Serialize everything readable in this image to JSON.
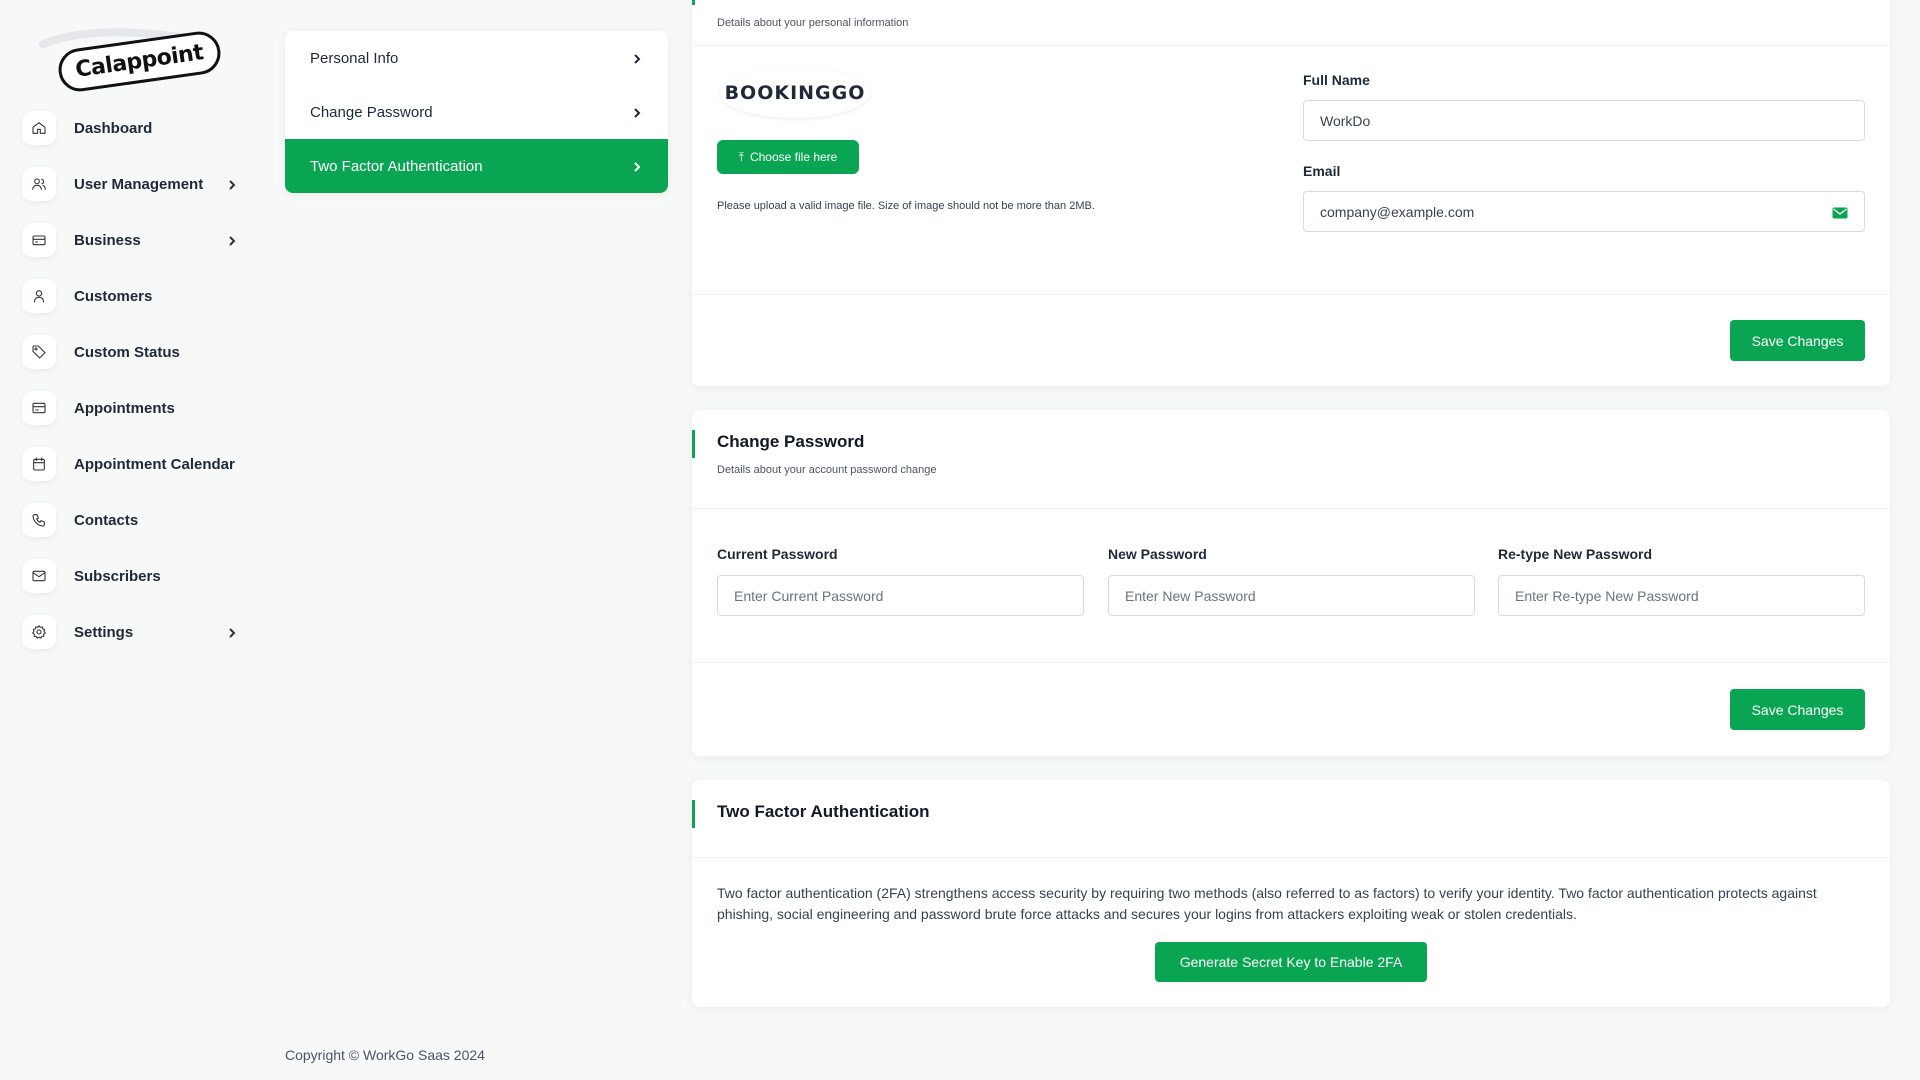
{
  "brand": {
    "name": "Calappoint"
  },
  "sidebar": {
    "items": [
      {
        "label": "Dashboard",
        "icon": "home-icon",
        "chevron": false
      },
      {
        "label": "User Management",
        "icon": "users-icon",
        "chevron": true
      },
      {
        "label": "Business",
        "icon": "briefcase-icon",
        "chevron": true
      },
      {
        "label": "Customers",
        "icon": "user-icon",
        "chevron": false
      },
      {
        "label": "Custom Status",
        "icon": "tag-icon",
        "chevron": false
      },
      {
        "label": "Appointments",
        "icon": "credit-card-icon",
        "chevron": false
      },
      {
        "label": "Appointment Calendar",
        "icon": "calendar-icon",
        "chevron": false
      },
      {
        "label": "Contacts",
        "icon": "phone-icon",
        "chevron": false
      },
      {
        "label": "Subscribers",
        "icon": "mail-icon",
        "chevron": false
      },
      {
        "label": "Settings",
        "icon": "gear-icon",
        "chevron": true
      }
    ]
  },
  "settings_menu": {
    "items": [
      {
        "label": "Personal Info",
        "active": false
      },
      {
        "label": "Change Password",
        "active": false
      },
      {
        "label": "Two Factor Authentication",
        "active": true
      }
    ]
  },
  "personal_info": {
    "subtitle": "Details about your personal information",
    "logo_text": "BOOKINGGO",
    "choose_file_label": "Choose file here",
    "upload_hint": "Please upload a valid image file. Size of image should not be more than 2MB.",
    "full_name_label": "Full Name",
    "full_name_value": "WorkDo",
    "email_label": "Email",
    "email_value": "company@example.com",
    "save_label": "Save Changes"
  },
  "change_password": {
    "title": "Change Password",
    "subtitle": "Details about your account password change",
    "current_label": "Current Password",
    "current_placeholder": "Enter Current Password",
    "new_label": "New Password",
    "new_placeholder": "Enter New Password",
    "retype_label": "Re-type New Password",
    "retype_placeholder": "Enter Re-type New Password",
    "save_label": "Save Changes"
  },
  "two_factor": {
    "title": "Two Factor Authentication",
    "description": "Two factor authentication (2FA) strengthens access security by requiring two methods (also referred to as factors) to verify your identity. Two factor authentication protects against phishing, social engineering and password brute force attacks and secures your logins from attackers exploiting weak or stolen credentials.",
    "generate_label": "Generate Secret Key to Enable 2FA"
  },
  "footer": {
    "copyright": "Copyright © WorkGo Saas 2024"
  },
  "colors": {
    "accent": "#0aa552",
    "background": "#f7f8f8"
  }
}
